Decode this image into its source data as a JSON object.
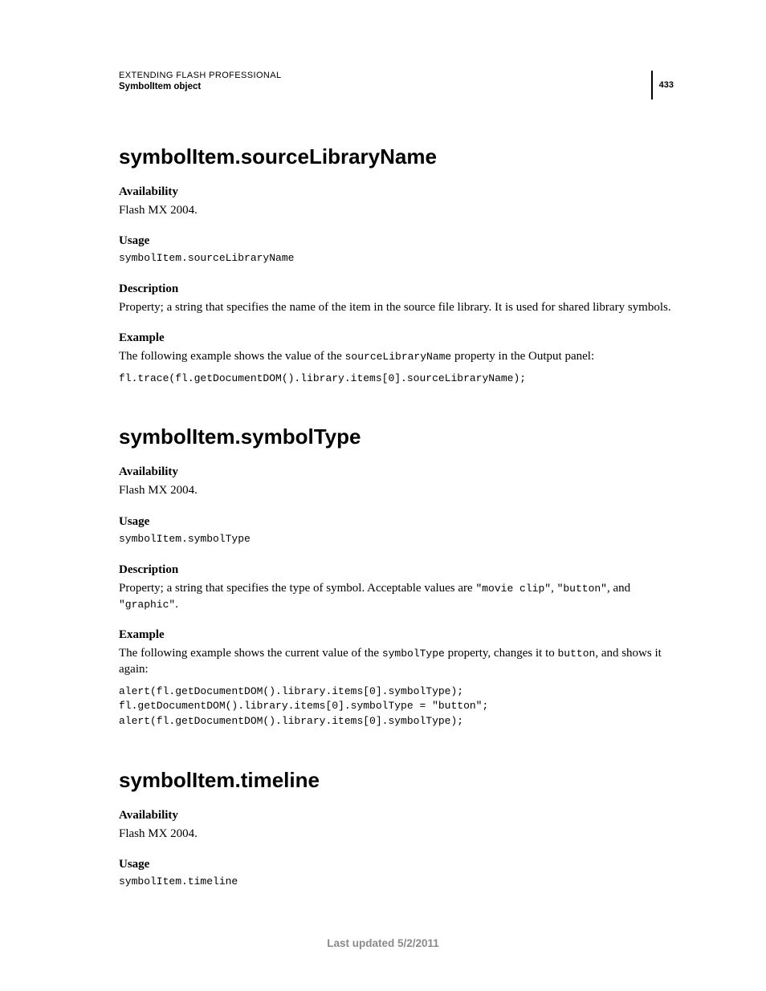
{
  "header": {
    "title": "EXTENDING FLASH PROFESSIONAL",
    "subtitle": "SymbolItem object",
    "page_number": "433"
  },
  "sections": [
    {
      "title": "symbolItem.sourceLibraryName",
      "availability_label": "Availability",
      "availability_text": "Flash MX 2004.",
      "usage_label": "Usage",
      "usage_code": "symbolItem.sourceLibraryName",
      "description_label": "Description",
      "description_text": "Property; a string that specifies the name of the item in the source file library. It is used for shared library symbols.",
      "example_label": "Example",
      "example_intro_pre": "The following example shows the value of the ",
      "example_intro_code": "sourceLibraryName",
      "example_intro_post": " property in the Output panel:",
      "example_code": "fl.trace(fl.getDocumentDOM().library.items[0].sourceLibraryName);"
    },
    {
      "title": "symbolItem.symbolType",
      "availability_label": "Availability",
      "availability_text": "Flash MX 2004.",
      "usage_label": "Usage",
      "usage_code": "symbolItem.symbolType",
      "description_label": "Description",
      "description_pre": "Property; a string that specifies the type of symbol. Acceptable values are ",
      "description_code1": "\"movie clip\"",
      "description_mid1": ", ",
      "description_code2": "\"button\"",
      "description_mid2": ", and ",
      "description_code3": "\"graphic\"",
      "description_post": ".",
      "example_label": "Example",
      "example_intro_pre": "The following example shows the current value of the ",
      "example_intro_code1": "symbolType",
      "example_intro_mid": " property, changes it to ",
      "example_intro_code2": "button",
      "example_intro_post": ", and shows it again:",
      "example_code": "alert(fl.getDocumentDOM().library.items[0].symbolType);\nfl.getDocumentDOM().library.items[0].symbolType = \"button\";\nalert(fl.getDocumentDOM().library.items[0].symbolType);"
    },
    {
      "title": "symbolItem.timeline",
      "availability_label": "Availability",
      "availability_text": "Flash MX 2004.",
      "usage_label": "Usage",
      "usage_code": "symbolItem.timeline"
    }
  ],
  "footer": "Last updated 5/2/2011"
}
